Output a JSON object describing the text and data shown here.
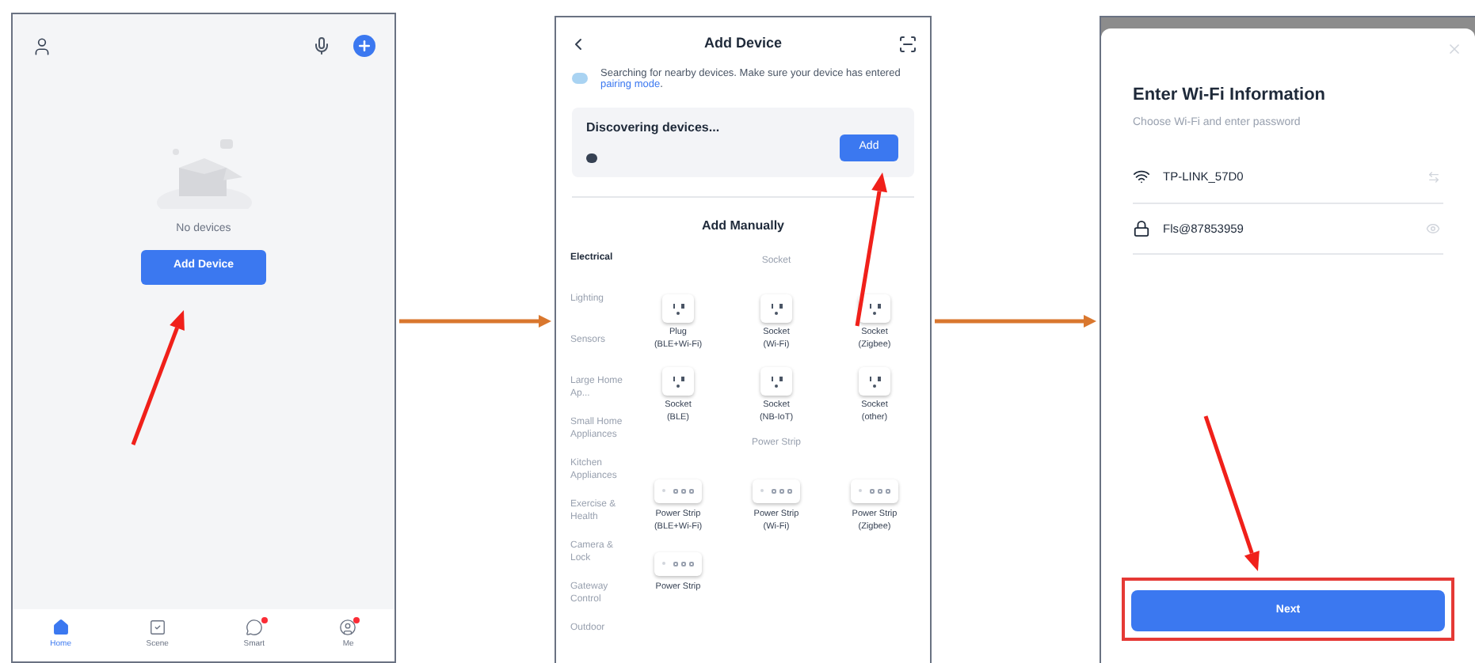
{
  "home_screen": {
    "empty_text": "No devices",
    "add_button": "Add Device",
    "nav_items": [
      {
        "label": "Home",
        "selected": true,
        "badge": false
      },
      {
        "label": "Scene",
        "selected": false,
        "badge": false
      },
      {
        "label": "Smart",
        "selected": false,
        "badge": true
      },
      {
        "label": "Me",
        "selected": false,
        "badge": true
      }
    ]
  },
  "add_device_screen": {
    "title": "Add Device",
    "notice": "Searching for nearby devices. Make sure your device has entered",
    "notice_link": "pairing mode",
    "notice_end": ".",
    "discover_title": "Discovering devices...",
    "add_button": "Add",
    "manual_title": "Add Manually",
    "categories": [
      {
        "label": "Electrical",
        "selected": true
      },
      {
        "label": "Lighting",
        "selected": false
      },
      {
        "label": "Sensors",
        "selected": false
      },
      {
        "label": "Large Home Ap...",
        "selected": false
      },
      {
        "label": "Small Home Appliances",
        "selected": false
      },
      {
        "label": "Kitchen Appliances",
        "selected": false
      },
      {
        "label": "Exercise & Health",
        "selected": false
      },
      {
        "label": "Camera & Lock",
        "selected": false
      },
      {
        "label": "Gateway Control",
        "selected": false
      },
      {
        "label": "Outdoor",
        "selected": false
      }
    ],
    "groups": [
      {
        "title": "Socket",
        "items": [
          {
            "kind": "socket",
            "name": "Plug",
            "detail": "(BLE+Wi-Fi)"
          },
          {
            "kind": "socket",
            "name": "Socket",
            "detail": "(Wi-Fi)"
          },
          {
            "kind": "socket",
            "name": "Socket",
            "detail": "(Zigbee)"
          },
          {
            "kind": "socket",
            "name": "Socket",
            "detail": "(BLE)"
          },
          {
            "kind": "socket",
            "name": "Socket",
            "detail": "(NB-IoT)"
          },
          {
            "kind": "socket",
            "name": "Socket",
            "detail": "(other)"
          }
        ]
      },
      {
        "title": "Power Strip",
        "items": [
          {
            "kind": "strip",
            "name": "Power Strip",
            "detail": "(BLE+Wi-Fi)"
          },
          {
            "kind": "strip",
            "name": "Power Strip",
            "detail": "(Wi-Fi)"
          },
          {
            "kind": "strip",
            "name": "Power Strip",
            "detail": "(Zigbee)"
          },
          {
            "kind": "strip",
            "name": "Power Strip"
          }
        ]
      }
    ]
  },
  "wifi_screen": {
    "title": "Enter Wi-Fi Information",
    "subtitle": "Choose Wi-Fi and enter password",
    "network": "TP-LINK_57D0",
    "password": "Fls@87853959",
    "next_button": "Next"
  }
}
